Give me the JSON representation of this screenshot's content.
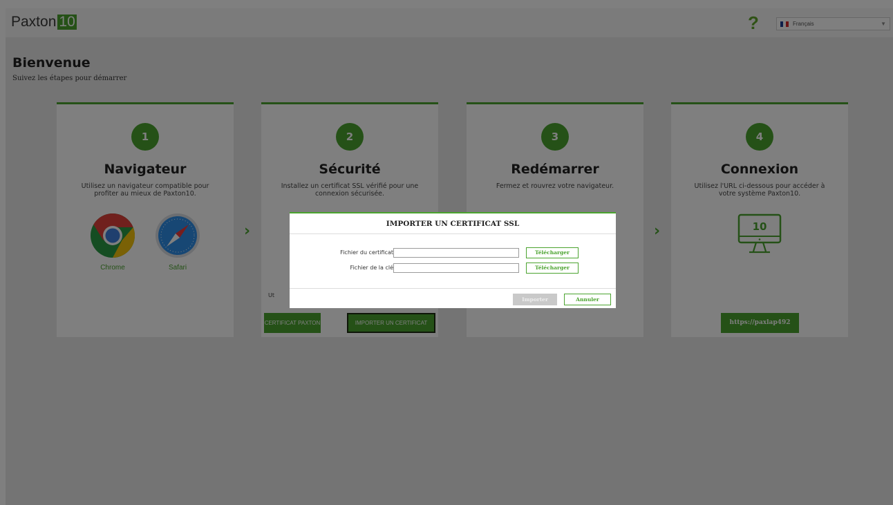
{
  "header": {
    "logo_text": "Paxton",
    "logo_number": "10",
    "help_symbol": "?",
    "language": "Français"
  },
  "page": {
    "title": "Bienvenue",
    "subtitle": "Suivez les étapes pour démarrer"
  },
  "steps": [
    {
      "number": "1",
      "title": "Navigateur",
      "description": "Utilisez un navigateur compatible pour profiter au mieux de Paxton10.",
      "browsers": [
        "Chrome",
        "Safari"
      ]
    },
    {
      "number": "2",
      "title": "Sécurité",
      "description": "Installez un certificat SSL vérifié pour une connexion sécurisée.",
      "partial_text": "Ut",
      "buttons": [
        "CERTIFICAT PAXTON",
        "IMPORTER UN CERTIFICAT"
      ]
    },
    {
      "number": "3",
      "title": "Redémarrer",
      "description": "Fermez et rouvrez votre navigateur."
    },
    {
      "number": "4",
      "title": "Connexion",
      "description": "Utilisez l'URL ci-dessous pour accéder à votre système Paxton10.",
      "monitor_label": "10",
      "url": "https://paxlap492"
    }
  ],
  "modal": {
    "title": "IMPORTER UN CERTIFICAT SSL",
    "fields": [
      {
        "label": "Fichier du certificat",
        "value": "",
        "button": "Télécharger"
      },
      {
        "label": "Fichier de la clé",
        "value": "",
        "button": "Télécharger"
      }
    ],
    "import_label": "Importer",
    "cancel_label": "Annuler"
  },
  "colors": {
    "accent": "#4aa32e",
    "background": "#e9e9e9",
    "overlay": "rgba(0,0,0,0.5)"
  },
  "icons": [
    "chrome-icon",
    "safari-icon",
    "monitor-icon",
    "chevron-right-icon",
    "help-icon",
    "france-flag-icon"
  ]
}
